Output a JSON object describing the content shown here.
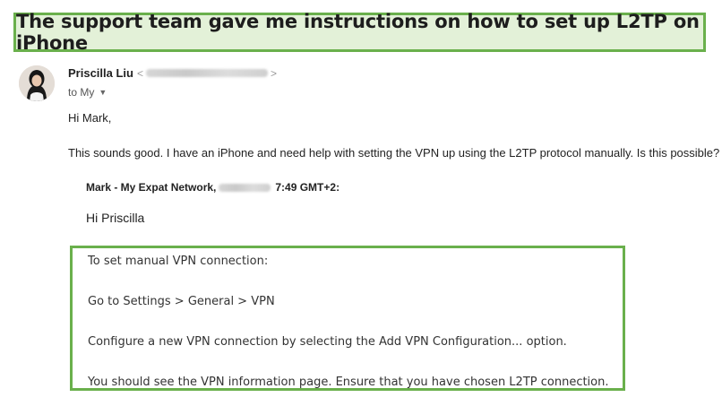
{
  "banner": {
    "text": "The support team gave me instructions on how to set up L2TP on iPhone"
  },
  "email": {
    "sender_name": "Priscilla Liu",
    "sender_email_prefix": "<",
    "sender_email_suffix": ">",
    "to_label": "to My",
    "greeting": "Hi Mark,",
    "body": "This sounds good. I have an iPhone and need help with setting the VPN up using the L2TP protocol manually. Is this possible?",
    "quoted": {
      "from": "Mark - My Expat Network,",
      "time": "7:49 GMT+2:",
      "greeting": "Hi Priscilla",
      "lines": [
        "To set manual VPN connection:",
        "Go to Settings > General > VPN",
        "Configure a new VPN connection by selecting the Add VPN Configuration... option.",
        "You should see the VPN information page. Ensure that you have chosen L2TP connection."
      ]
    }
  },
  "colors": {
    "highlight_border": "#6ab04c",
    "banner_background": "#e3f1d8"
  },
  "icons": {
    "caret": "chevron-down-icon",
    "avatar": "avatar"
  }
}
